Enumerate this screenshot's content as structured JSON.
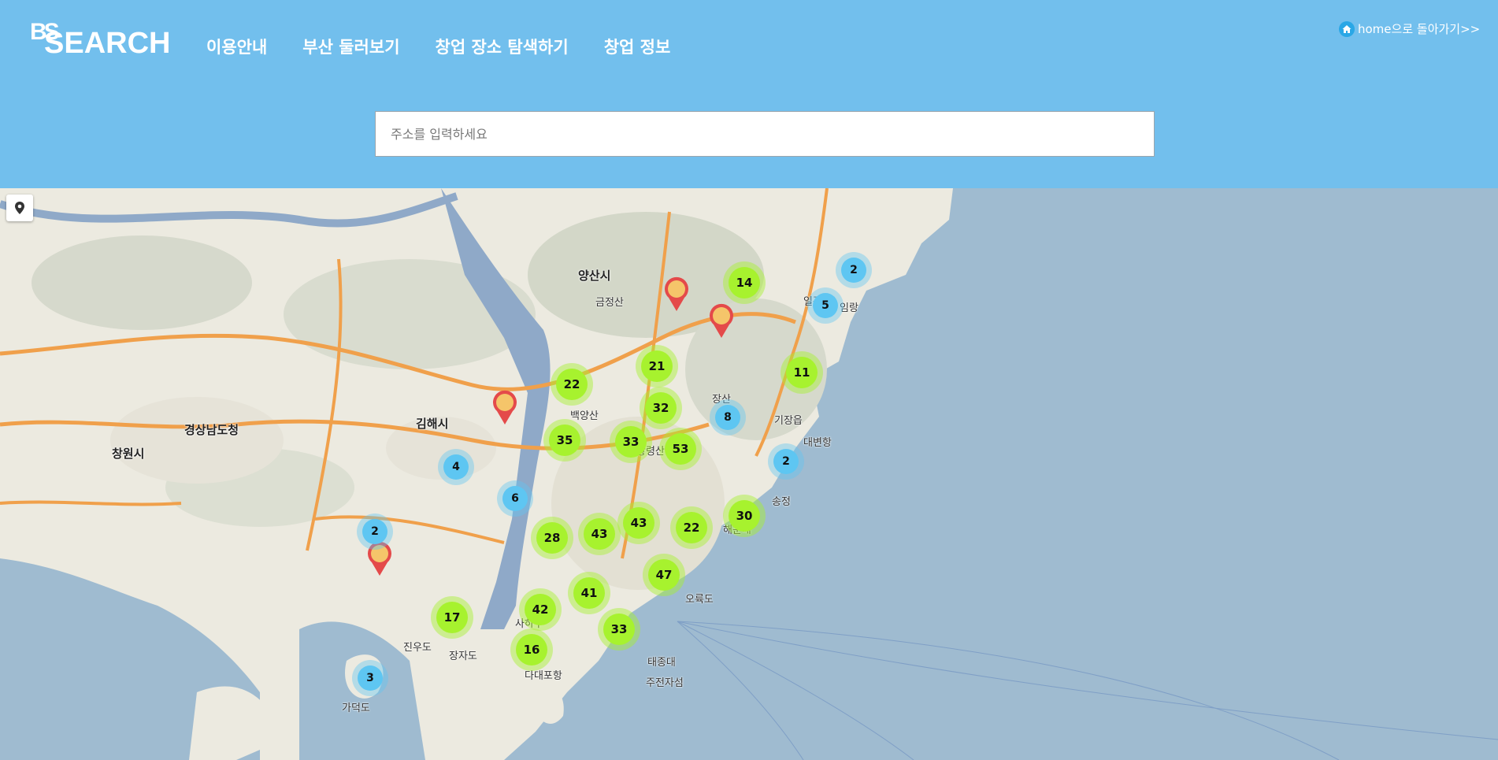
{
  "header": {
    "logo_top": "BS",
    "logo_main": "SEARCH",
    "nav": [
      "이용안내",
      "부산 둘러보기",
      "창업 장소 탐색하기",
      "창업 정보"
    ],
    "home_link": "home으로 돌아가기>>"
  },
  "search": {
    "placeholder": "주소를 입력하세요",
    "value": ""
  },
  "colors": {
    "header_bg": "#72bfed",
    "cluster_green": "#a7f22e",
    "cluster_blue": "#5ec6f2",
    "pin_red": "#e44a4a",
    "sea": "#9fbbd0"
  },
  "map": {
    "locate_button_icon": "location-pin-icon",
    "places": [
      "양산시",
      "김해시",
      "경상남도청",
      "창원시",
      "기장읍",
      "해운대",
      "송정",
      "사하구",
      "다대포항",
      "가덕도",
      "진우도",
      "장자도",
      "태종대",
      "오륙도",
      "주전자섬",
      "임랑",
      "일광",
      "대변항",
      "금정산",
      "백양산",
      "황령산",
      "장산"
    ],
    "clusters": [
      {
        "count": "14",
        "kind": "green"
      },
      {
        "count": "2",
        "kind": "blue"
      },
      {
        "count": "5",
        "kind": "blue"
      },
      {
        "count": "21",
        "kind": "green"
      },
      {
        "count": "11",
        "kind": "green"
      },
      {
        "count": "22",
        "kind": "green"
      },
      {
        "count": "32",
        "kind": "green"
      },
      {
        "count": "8",
        "kind": "blue"
      },
      {
        "count": "35",
        "kind": "green"
      },
      {
        "count": "33",
        "kind": "green"
      },
      {
        "count": "53",
        "kind": "green"
      },
      {
        "count": "2",
        "kind": "blue"
      },
      {
        "count": "4",
        "kind": "blue"
      },
      {
        "count": "6",
        "kind": "blue"
      },
      {
        "count": "28",
        "kind": "green"
      },
      {
        "count": "43",
        "kind": "green"
      },
      {
        "count": "43",
        "kind": "green"
      },
      {
        "count": "22",
        "kind": "green"
      },
      {
        "count": "30",
        "kind": "green"
      },
      {
        "count": "2",
        "kind": "blue"
      },
      {
        "count": "47",
        "kind": "green"
      },
      {
        "count": "41",
        "kind": "green"
      },
      {
        "count": "42",
        "kind": "green"
      },
      {
        "count": "17",
        "kind": "green"
      },
      {
        "count": "33",
        "kind": "green"
      },
      {
        "count": "16",
        "kind": "green"
      },
      {
        "count": "3",
        "kind": "blue"
      }
    ]
  }
}
